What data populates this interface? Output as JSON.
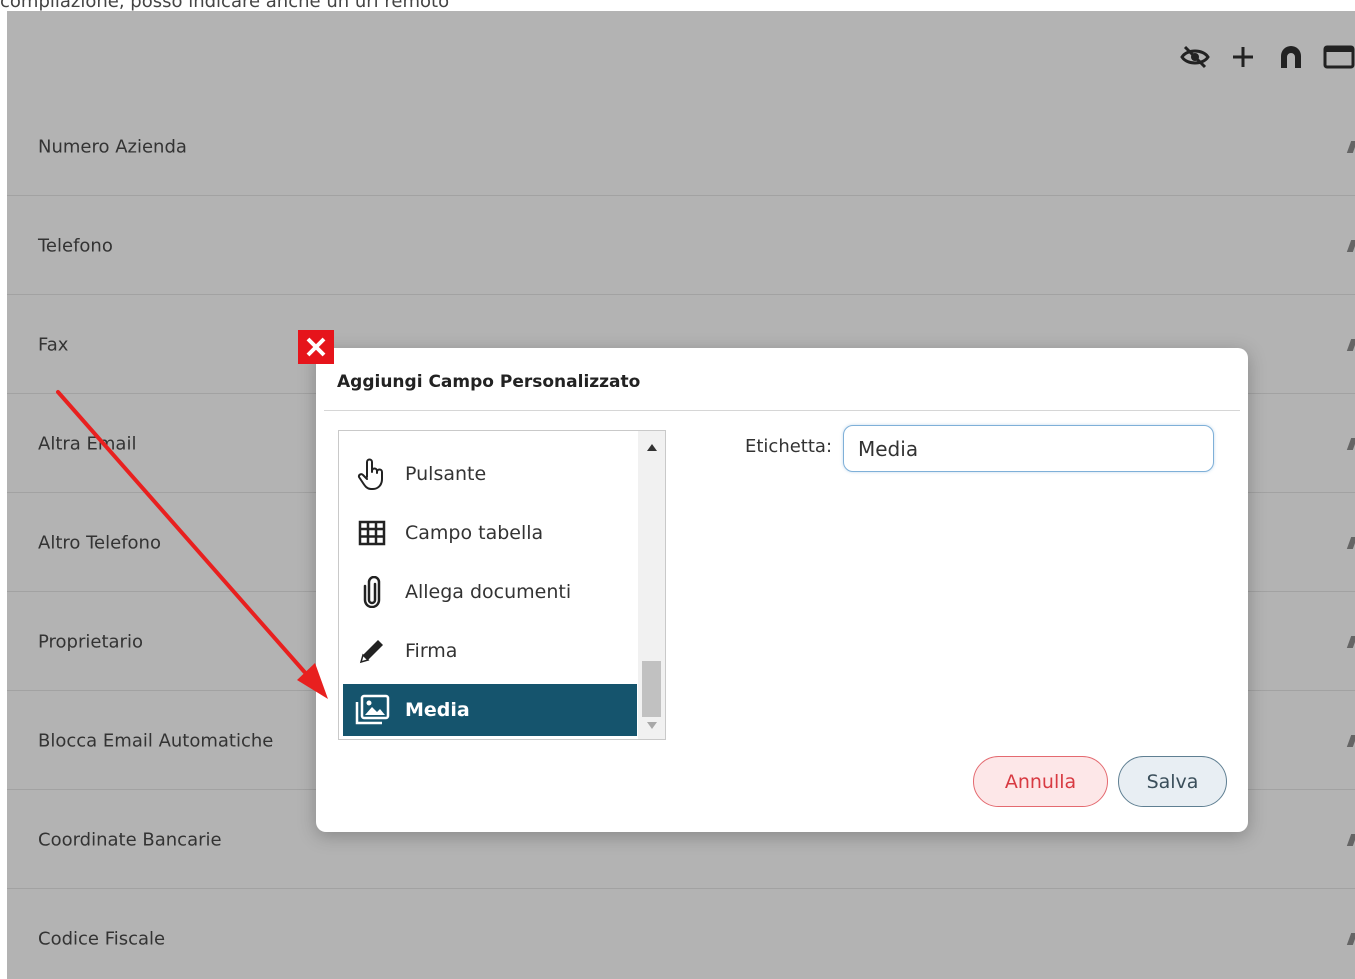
{
  "caption": "compilazione, posso indicare anche un url remoto",
  "toolbar": [
    {
      "name": "hide-icon"
    },
    {
      "name": "add-icon"
    },
    {
      "name": "magnet-icon"
    },
    {
      "name": "window-icon"
    }
  ],
  "fields": [
    "Numero Azienda",
    "Telefono",
    "Fax",
    "Altra Email",
    "Altro Telefono",
    "Proprietario",
    "Blocca Email Automatiche",
    "Coordinate Bancarie",
    "Codice Fiscale"
  ],
  "modal": {
    "title": "Aggiungi Campo Personalizzato",
    "types": [
      {
        "label": "Pulsante",
        "icon": "hand-pointer-icon"
      },
      {
        "label": "Campo tabella",
        "icon": "table-icon"
      },
      {
        "label": "Allega documenti",
        "icon": "paperclip-icon"
      },
      {
        "label": "Firma",
        "icon": "pencil-icon"
      },
      {
        "label": "Media",
        "icon": "media-icon"
      }
    ],
    "selected_type": "Media",
    "label_caption": "Etichetta:",
    "label_value": "Media",
    "cancel_label": "Annulla",
    "save_label": "Salva"
  },
  "colors": {
    "overlay": "#b3b3b3",
    "selected": "#15546d",
    "close": "#e6141b",
    "arrow": "#e8201f"
  }
}
